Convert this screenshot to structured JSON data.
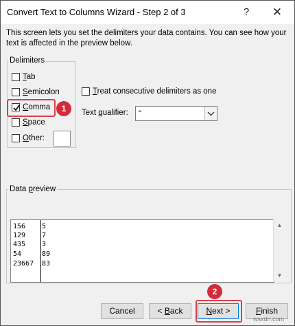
{
  "window": {
    "title": "Convert Text to Columns Wizard - Step 2 of 3",
    "help_glyph": "?",
    "close_glyph": "✕"
  },
  "intro_text": "This screen lets you set the delimiters your data contains.  You can see how your text is affected in the preview below.",
  "delimiters": {
    "label": "Delimiters",
    "options": [
      {
        "pre": "",
        "key": "T",
        "post": "ab",
        "checked": false
      },
      {
        "pre": "",
        "key": "S",
        "post": "emicolon",
        "checked": false
      },
      {
        "pre": "",
        "key": "C",
        "post": "omma",
        "checked": true
      },
      {
        "pre": "",
        "key": "S",
        "post": "pace",
        "checked": false
      },
      {
        "pre": "",
        "key": "O",
        "post": "ther:",
        "checked": false
      }
    ],
    "other_value": ""
  },
  "consecutive": {
    "key": "T",
    "rest": "reat consecutive delimiters as one",
    "checked": false
  },
  "text_qualifier": {
    "pre": "Text ",
    "key": "q",
    "post": "ualifier:",
    "value": "\""
  },
  "preview": {
    "label_pre": "Data ",
    "label_key": "p",
    "label_post": "review",
    "rows": [
      [
        "156",
        "5"
      ],
      [
        "129",
        "7"
      ],
      [
        "435",
        "3"
      ],
      [
        "54",
        "89"
      ],
      [
        "23667",
        "83"
      ]
    ]
  },
  "buttons": {
    "cancel": "Cancel",
    "back_pre": "< ",
    "back_key": "B",
    "back_post": "ack",
    "next_key": "N",
    "next_post": "ext >",
    "finish_key": "F",
    "finish_post": "inish"
  },
  "annotations": {
    "badge1": "1",
    "badge2": "2",
    "color": "#d42b3a"
  },
  "watermark": "wsxdn.com"
}
